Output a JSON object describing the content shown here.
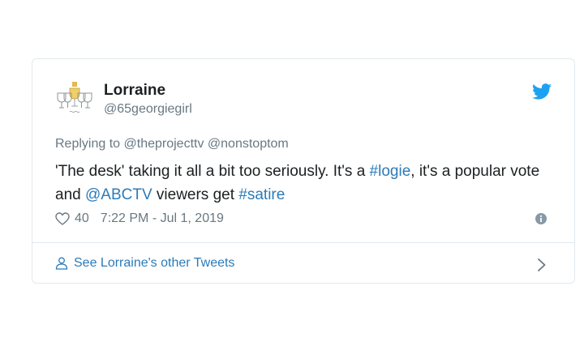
{
  "tweet": {
    "author": {
      "name": "Lorraine",
      "handle": "@65georgiegirl",
      "avatar_icon": "champagne-glasses-icon"
    },
    "replying_to": {
      "prefix": "Replying to",
      "mentions": [
        "@theprojecttv",
        "@nonstoptom"
      ]
    },
    "text": {
      "part1": "'The desk' taking it all a bit too seriously. It's a ",
      "hashtag1": "#logie",
      "part2": ", it's a popular vote and ",
      "mention": "@ABCTV",
      "part3": " viewers get ",
      "hashtag2": "#satire"
    },
    "likes": "40",
    "timestamp": "7:22 PM - Jul 1, 2019",
    "footer_link": "See Lorraine's other Tweets"
  },
  "colors": {
    "link": "#2b7bb9",
    "twitter_blue": "#1da1f2",
    "muted": "#697882",
    "border": "#e1e8ed"
  },
  "icons": {
    "brand": "twitter-bird-icon",
    "like": "heart-icon",
    "info": "info-icon",
    "profile": "person-icon",
    "chevron": "chevron-right-icon"
  }
}
